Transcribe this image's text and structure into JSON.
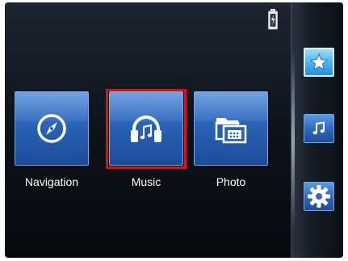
{
  "status": {
    "battery_icon": "battery-charging-icon"
  },
  "menu": {
    "items": [
      {
        "label": "Navigation",
        "icon": "compass-icon",
        "selected": false
      },
      {
        "label": "Music",
        "icon": "headphones-icon",
        "selected": true
      },
      {
        "label": "Photo",
        "icon": "photo-folder-icon",
        "selected": false
      }
    ]
  },
  "sidebar": {
    "items": [
      {
        "icon": "star-icon",
        "active": true
      },
      {
        "icon": "music-note-icon",
        "active": false
      },
      {
        "icon": "gear-icon",
        "active": false
      }
    ]
  },
  "colors": {
    "tile": "#2a63b8",
    "selection": "#e01010",
    "active_rail": "#4fb3f2",
    "background": "#0d1218"
  }
}
